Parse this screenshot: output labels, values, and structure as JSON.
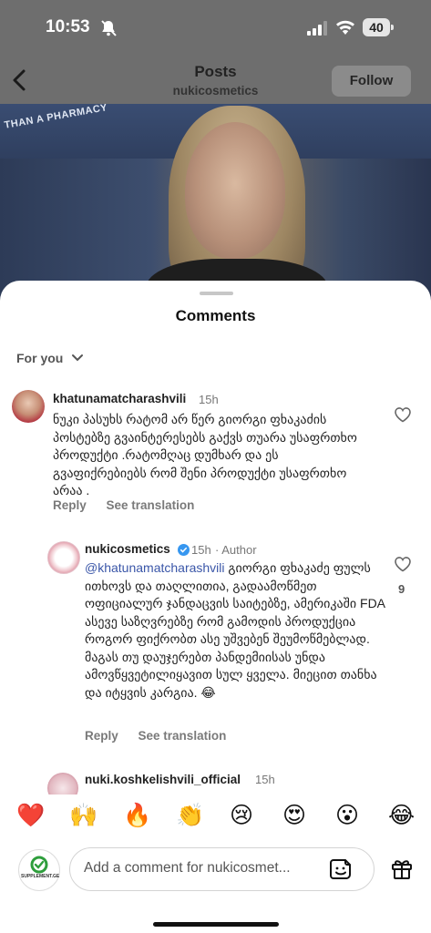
{
  "status_bar": {
    "time": "10:53",
    "battery": "40"
  },
  "nav": {
    "title": "Posts",
    "subtitle": "nukicosmetics",
    "follow_label": "Follow"
  },
  "post": {
    "store_sign": "THAN A PHARMACY"
  },
  "comments_sheet": {
    "title": "Comments",
    "sort_label": "For you",
    "comments": [
      {
        "username": "khatunamatcharashvili",
        "time": "15h",
        "text": "ნუკი პასუხს რატომ არ წერ გიორგი ფხაკაძის პოსტებზე გვაინტერესებს გაქვს თუარა უსაფრთხო პროდუქტი .რატომღაც დუმხარ და ეს გვაფიქრებიებს რომ შენი პროდუქტი უსაფრთხო არაა .",
        "reply": "Reply",
        "see_translation": "See translation"
      }
    ],
    "reply_comment": {
      "username": "nukicosmetics",
      "time": "15h",
      "author_tag": "· Author",
      "mention": "@khatunamatcharashvili",
      "text": "გიორგი ფხაკაძე ფულს ითხოვს და თაღლითია, გადაამოწმეთ ოფიციალურ ჯანდაცვის საიტებზე, ამერიკაში FDA ასევე საზღვრებზე რომ გამოდის პროდუქცია როგორ ფიქრობთ ასე უშვებენ შეუმოწმებლად. მაგას თუ დაუჯერებთ პანდემიისას უნდა ამოვწყვეტილიყავით სულ ყველა. მიეცით თანხა და იტყვის კარგია. 😂",
      "likes": "9",
      "reply": "Reply",
      "see_translation": "See translation"
    },
    "next_comment": {
      "username": "nuki.koshkelishvili_official",
      "time": "15h"
    }
  },
  "quick_emojis": [
    "❤️",
    "🙌",
    "🔥",
    "👏",
    "😢",
    "😍",
    "😮",
    "😂"
  ],
  "composer": {
    "placeholder": "Add a comment for nukicosmet...",
    "self_avatar_label": "SUPPLEMENT.GE"
  },
  "colors": {
    "mention": "#3a56a8",
    "verified": "#3797f0",
    "heart": "#ed4956"
  }
}
